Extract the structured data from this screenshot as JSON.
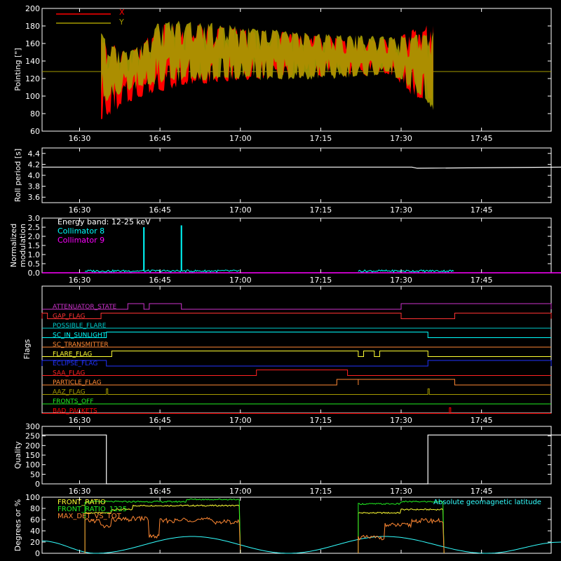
{
  "figure": {
    "background": "#000000",
    "axis_color": "#ffffff"
  },
  "time_axis": {
    "ticks": [
      "16:30",
      "16:45",
      "17:00",
      "17:15",
      "17:30",
      "17:45"
    ],
    "tick_minutes": [
      990,
      1005,
      1020,
      1035,
      1050,
      1065
    ],
    "range_minutes": [
      983,
      1078
    ]
  },
  "chart_data": [
    {
      "id": "pointing",
      "type": "line",
      "ylabel": "Pointing [\"]",
      "ylim": [
        60,
        200
      ],
      "yticks": [
        60,
        80,
        100,
        120,
        140,
        160,
        180,
        200
      ],
      "legend": [
        {
          "name": "X",
          "color": "#ff0000"
        },
        {
          "name": "Y",
          "color": "#a59a00"
        }
      ],
      "baseline": {
        "value": 128,
        "color": "#a59a00"
      },
      "series": [
        {
          "name": "X",
          "color": "#ff0000",
          "time": [
            "16:34",
            "16:36",
            "16:39",
            "16:42",
            "16:45",
            "16:50",
            "17:00",
            "17:10",
            "17:20",
            "17:28",
            "17:33",
            "17:36"
          ],
          "upper": [
            168,
            160,
            150,
            162,
            185,
            183,
            178,
            172,
            168,
            165,
            180,
            182
          ],
          "lower": [
            68,
            80,
            92,
            100,
            105,
            112,
            118,
            120,
            122,
            124,
            95,
            92
          ]
        },
        {
          "name": "Y",
          "color": "#a59a00",
          "time": [
            "16:34",
            "16:36",
            "16:39",
            "16:42",
            "16:45",
            "16:50",
            "17:00",
            "17:10",
            "17:20",
            "17:28",
            "17:33",
            "17:36"
          ],
          "upper": [
            172,
            160,
            152,
            160,
            188,
            187,
            180,
            174,
            170,
            168,
            172,
            175
          ],
          "lower": [
            90,
            98,
            105,
            110,
            114,
            117,
            118,
            118,
            120,
            125,
            102,
            82
          ]
        }
      ]
    },
    {
      "id": "roll",
      "type": "line",
      "ylabel": "Roll period [s]",
      "ylim": [
        3.5,
        4.5
      ],
      "yticks": [
        3.6,
        3.8,
        4.0,
        4.2,
        4.4
      ],
      "series": [
        {
          "name": "",
          "color": "#ffffff",
          "time": [
            "16:23",
            "17:32",
            "17:33",
            "18:00"
          ],
          "values": [
            4.15,
            4.15,
            4.13,
            4.15
          ]
        }
      ]
    },
    {
      "id": "modulation",
      "type": "line",
      "ylabel": "Normalized modulation",
      "ylim": [
        0.0,
        3.0
      ],
      "yticks": [
        0.0,
        0.5,
        1.0,
        1.5,
        2.0,
        2.5,
        3.0
      ],
      "legend": [
        {
          "name": "Energy band: 12-25 keV",
          "color": "#ffffff"
        },
        {
          "name": "Collimator 8",
          "color": "#00ffff"
        },
        {
          "name": "Collimator 9",
          "color": "#ff00ff"
        }
      ],
      "series": [
        {
          "name": "Collimator 8",
          "color": "#00ffff",
          "segments": [
            {
              "start": "16:31",
              "end": "17:00",
              "level": 0.1
            },
            {
              "start": "17:22",
              "end": "17:40",
              "level": 0.1
            }
          ],
          "spikes": [
            {
              "time": "16:42",
              "value": 2.5
            },
            {
              "time": "16:49",
              "value": 2.6
            }
          ]
        },
        {
          "name": "Collimator 9",
          "color": "#ff00ff",
          "time": [
            "16:23",
            "18:00"
          ],
          "values": [
            0.0,
            0.0
          ]
        }
      ]
    },
    {
      "id": "flags",
      "type": "line",
      "ylabel": "Flags",
      "flags": [
        {
          "name": "ATTENUATOR_STATE",
          "color": "#cc33cc",
          "on": [
            [
              "16:39",
              "16:42"
            ],
            [
              "16:43",
              "16:49"
            ],
            [
              "17:30",
              "18:00"
            ]
          ]
        },
        {
          "name": "GAP_FLAG",
          "color": "#ff3333",
          "on": [
            [
              "16:23",
              "16:24"
            ],
            [
              "16:34",
              "17:30"
            ],
            [
              "17:40",
              "18:00"
            ]
          ]
        },
        {
          "name": "POSSIBLE_FLARE",
          "color": "#00cccc",
          "on": []
        },
        {
          "name": "SC_IN_SUNLIGHT",
          "color": "#00ffff",
          "on": [
            [
              "16:35",
              "17:35"
            ]
          ]
        },
        {
          "name": "SC_TRANSMITTER",
          "color": "#ff8833",
          "on": []
        },
        {
          "name": "FLARE_FLAG",
          "color": "#ffff33",
          "on": [
            [
              "16:36",
              "17:22"
            ],
            [
              "17:23",
              "17:25"
            ],
            [
              "17:26",
              "17:35"
            ]
          ]
        },
        {
          "name": "ECLIPSE_FLAG",
          "color": "#2233ff",
          "on": [
            [
              "16:23",
              "16:35"
            ],
            [
              "17:35",
              "18:00"
            ]
          ]
        },
        {
          "name": "SAA_FLAG",
          "color": "#ff2222",
          "on": [
            [
              "17:03",
              "17:20"
            ]
          ]
        },
        {
          "name": "PARTICLE_FLAG",
          "color": "#ff8833",
          "on": [
            [
              "17:18",
              "17:22"
            ],
            [
              "17:22",
              "17:40"
            ]
          ]
        },
        {
          "name": "AAZ_FLAG",
          "color": "#a59a00",
          "on": [
            [
              "16:35",
              "16:35"
            ],
            [
              "17:35",
              "17:35"
            ]
          ]
        },
        {
          "name": "FRONTS_OFF",
          "color": "#22ee22",
          "on": []
        },
        {
          "name": "BAD_PACKETS",
          "color": "#ff0000",
          "on": [
            [
              "17:39",
              "17:39"
            ]
          ]
        }
      ]
    },
    {
      "id": "quality",
      "type": "line",
      "ylabel": "Quality",
      "ylim": [
        0,
        300
      ],
      "yticks": [
        0,
        50,
        100,
        150,
        200,
        250,
        300
      ],
      "series": [
        {
          "name": "",
          "color": "#ffffff",
          "time": [
            "16:23",
            "16:35",
            "16:35",
            "17:35",
            "17:35",
            "18:00"
          ],
          "values": [
            255,
            255,
            0,
            0,
            255,
            255
          ]
        }
      ]
    },
    {
      "id": "ratios",
      "type": "line",
      "ylabel": "Degrees or %",
      "ylim": [
        0,
        100
      ],
      "yticks": [
        0,
        20,
        40,
        60,
        80,
        100
      ],
      "legend": [
        {
          "name": "FRONT_RATIO",
          "color": "#ffff33"
        },
        {
          "name": "FRONT_RATIO_1225",
          "color": "#22ee22"
        },
        {
          "name": "MAX_DET_VS_TOT",
          "color": "#ff8833"
        }
      ],
      "annotation": {
        "text": "Absolute geomagnetic latitude",
        "color": "#33ffff"
      },
      "intervals": [
        {
          "start": "16:31",
          "end": "17:00"
        },
        {
          "start": "17:22",
          "end": "17:38"
        }
      ],
      "series": [
        {
          "name": "FRONT_RATIO",
          "color": "#ffff33",
          "levels": [
            [
              "16:31",
              72
            ],
            [
              "16:36",
              78
            ],
            [
              "16:40",
              85
            ],
            [
              "16:52",
              85
            ],
            [
              "17:22",
              72
            ],
            [
              "17:30",
              78
            ]
          ]
        },
        {
          "name": "FRONT_RATIO_1225",
          "color": "#22ee22",
          "levels": [
            [
              "16:31",
              92
            ],
            [
              "16:50",
              96
            ],
            [
              "17:22",
              88
            ],
            [
              "17:30",
              92
            ]
          ]
        },
        {
          "name": "MAX_DET_VS_TOT",
          "color": "#ff8833",
          "levels": [
            [
              "16:31",
              58
            ],
            [
              "16:34",
              48
            ],
            [
              "16:36",
              60
            ],
            [
              "16:40",
              62
            ],
            [
              "16:43",
              30
            ],
            [
              "16:45",
              58
            ],
            [
              "16:49",
              60
            ],
            [
              "16:55",
              56
            ],
            [
              "17:22",
              28
            ],
            [
              "17:27",
              50
            ],
            [
              "17:32",
              58
            ]
          ]
        },
        {
          "name": "Absolute geomagnetic latitude",
          "color": "#33ffff",
          "time": [
            "16:23",
            "16:33",
            "16:51",
            "17:09",
            "17:27",
            "17:46",
            "18:00"
          ],
          "values": [
            22,
            0,
            30,
            0,
            30,
            0,
            20
          ]
        }
      ]
    }
  ]
}
